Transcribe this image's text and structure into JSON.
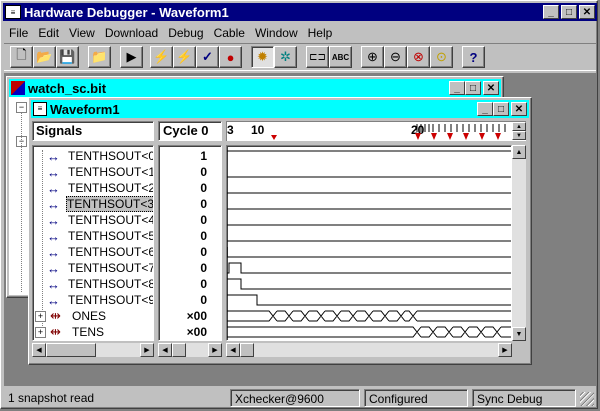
{
  "app": {
    "title": "Hardware Debugger - Waveform1"
  },
  "menu": [
    "File",
    "Edit",
    "View",
    "Download",
    "Debug",
    "Cable",
    "Window",
    "Help"
  ],
  "toolbar_icons": [
    "new-icon",
    "open-icon",
    "save-icon",
    "folder-icon",
    "run-icon",
    "trigger-icon",
    "step-icon",
    "check-icon",
    "stop-icon",
    "cycle-icon",
    "bug-icon",
    "waveform-icon",
    "abc-icon",
    "zoom-in-icon",
    "zoom-out-icon",
    "zoom-fit-icon",
    "zoom-find-icon",
    "help-icon"
  ],
  "toolbar_texts": {
    "abc": "ABC"
  },
  "bg_window": {
    "title": "watch_sc.bit"
  },
  "waveform": {
    "title": "Waveform1",
    "signals_header": "Signals",
    "cycle_header": "Cycle 0",
    "ruler_labels": [
      "3",
      "10",
      "20"
    ],
    "signals": [
      {
        "name": "TENTHSOUT<0",
        "value": "1"
      },
      {
        "name": "TENTHSOUT<1",
        "value": "0"
      },
      {
        "name": "TENTHSOUT<2",
        "value": "0"
      },
      {
        "name": "TENTHSOUT<3",
        "value": "0"
      },
      {
        "name": "TENTHSOUT<4",
        "value": "0"
      },
      {
        "name": "TENTHSOUT<5",
        "value": "0"
      },
      {
        "name": "TENTHSOUT<6",
        "value": "0"
      },
      {
        "name": "TENTHSOUT<7",
        "value": "0"
      },
      {
        "name": "TENTHSOUT<8",
        "value": "0"
      },
      {
        "name": "TENTHSOUT<9",
        "value": "0"
      },
      {
        "name": "ONES",
        "value": "×00"
      },
      {
        "name": "TENS",
        "value": "×00"
      }
    ]
  },
  "statusbar": {
    "message": "1 snapshot read",
    "cable": "Xchecker@9600",
    "state": "Configured",
    "mode": "Sync Debug"
  },
  "colors": {
    "titlebar": "#000080",
    "mdi_title": "#00ffff",
    "marker": "#cc0000",
    "bus_icon": "#800000",
    "arrow": "#000080"
  }
}
